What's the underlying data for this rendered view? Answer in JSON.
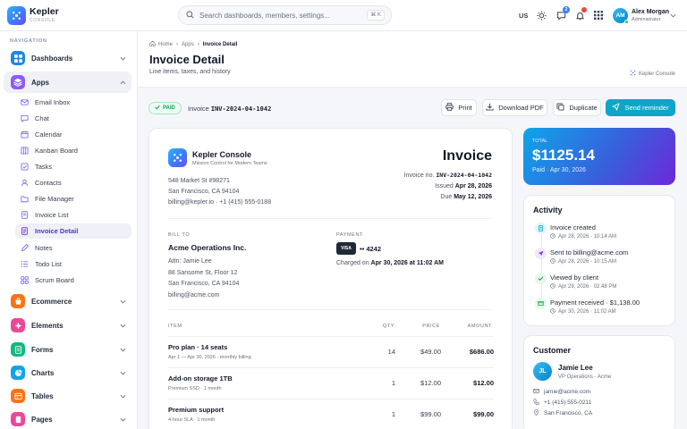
{
  "app": {
    "name": "Kepler",
    "sub": "CONSOLE"
  },
  "search": {
    "placeholder": "Search dashboards, members, settings...",
    "shortcut": "⌘ K"
  },
  "topbar": {
    "lang": "US",
    "messages_badge": "2",
    "notifications_badge": "",
    "user_name": "Alex Morgan",
    "user_role": "Administrator",
    "user_initials": "AM"
  },
  "sidebar": {
    "section": "NAVIGATION",
    "groups": [
      {
        "label": "Dashboards",
        "icon": "dashboard-icon",
        "color": "#1e88e5"
      },
      {
        "label": "Apps",
        "icon": "apps-icon",
        "color": "#8b5cf6"
      },
      {
        "label": "Ecommerce",
        "icon": "cart-icon",
        "color": "#f97316"
      },
      {
        "label": "Elements",
        "icon": "elements-icon",
        "color": "#ec4899"
      },
      {
        "label": "Forms",
        "icon": "forms-icon",
        "color": "#10b981"
      },
      {
        "label": "Charts",
        "icon": "chart-icon",
        "color": "#0ea5e9"
      },
      {
        "label": "Tables",
        "icon": "table-icon",
        "color": "#f97316"
      },
      {
        "label": "Pages",
        "icon": "pages-icon",
        "color": "#ec4899"
      }
    ],
    "apps": [
      {
        "label": "Email Inbox",
        "icon": "mail-icon"
      },
      {
        "label": "Chat",
        "icon": "chat-icon"
      },
      {
        "label": "Calendar",
        "icon": "calendar-icon"
      },
      {
        "label": "Kanban Board",
        "icon": "kanban-icon"
      },
      {
        "label": "Tasks",
        "icon": "tasks-icon"
      },
      {
        "label": "Contacts",
        "icon": "contacts-icon"
      },
      {
        "label": "File Manager",
        "icon": "folder-icon"
      },
      {
        "label": "Invoice List",
        "icon": "invoice-list-icon"
      },
      {
        "label": "Invoice Detail",
        "icon": "invoice-detail-icon"
      },
      {
        "label": "Notes",
        "icon": "notes-icon"
      },
      {
        "label": "Todo List",
        "icon": "todo-icon"
      },
      {
        "label": "Scrum Board",
        "icon": "scrum-icon"
      }
    ]
  },
  "breadcrumb": [
    "Home",
    "Apps",
    "Invoice Detail"
  ],
  "page": {
    "title": "Invoice Detail",
    "subtitle": "Line items, taxes, and history",
    "brand": "Kepler Console"
  },
  "status": {
    "badge": "PAID",
    "invoice_label": "Invoice",
    "invoice_id": "INV-2024-04-1042"
  },
  "actions": {
    "print": "Print",
    "download": "Download PDF",
    "duplicate": "Duplicate",
    "send": "Send reminder"
  },
  "company": {
    "name": "Kepler Console",
    "tagline": "Mission Control for Modern Teams",
    "address1": "548 Market St #98271",
    "address2": "San Francisco, CA 94104",
    "contact": "billing@kepler.io · +1 (415) 555-0188"
  },
  "invoice": {
    "heading": "Invoice",
    "no_label": "Invoice no.",
    "no": "INV-2024-04-1042",
    "issued_label": "Issued",
    "issued": "Apr 28, 2026",
    "due_label": "Due",
    "due": "May 12, 2026"
  },
  "bill_to": {
    "label": "BILL TO",
    "name": "Acme Operations Inc.",
    "attn": "Attn: Jamie Lee",
    "line1": "88 Sansome St, Floor 12",
    "line2": "San Francisco, CA 94104",
    "email": "billing@acme.com"
  },
  "payment": {
    "label": "PAYMENT",
    "brand": "VISA",
    "last4": "•• 4242",
    "charged_prefix": "Charged on",
    "charged": "Apr 30, 2026 at 11:02 AM"
  },
  "table": {
    "headers": {
      "item": "ITEM",
      "qty": "QTY",
      "price": "PRICE",
      "amount": "AMOUNT"
    },
    "rows": [
      {
        "name": "Pro plan · 14 seats",
        "desc": "Apr 1 — Apr 30, 2026 · monthly billing",
        "qty": "14",
        "price": "$49.00",
        "amount": "$686.00"
      },
      {
        "name": "Add-on storage 1TB",
        "desc": "Premium SSD · 1 month",
        "qty": "1",
        "price": "$12.00",
        "amount": "$12.00"
      },
      {
        "name": "Premium support",
        "desc": "4-hour SLA · 1 month",
        "qty": "1",
        "price": "$99.00",
        "amount": "$99.00"
      }
    ]
  },
  "total": {
    "label": "TOTAL",
    "amount": "$1125.14",
    "note": "Paid · Apr 30, 2026"
  },
  "activity": {
    "title": "Activity",
    "events": [
      {
        "title": "Invoice created",
        "time": "Apr 28, 2026 · 10:14 AM",
        "icon": "document-icon",
        "color": "#0ea5c6",
        "bg": "#e0f7fb"
      },
      {
        "title": "Sent to billing@acme.com",
        "time": "Apr 28, 2026 · 10:15 AM",
        "icon": "send-icon",
        "color": "#7c3aed",
        "bg": "#efe9ff"
      },
      {
        "title": "Viewed by client",
        "time": "Apr 29, 2026 · 02:48 PM",
        "icon": "check-icon",
        "color": "#16a34a",
        "bg": "#e6f8ec"
      },
      {
        "title": "Payment received · $1,138.00",
        "time": "Apr 30, 2026 · 11:02 AM",
        "icon": "card-icon",
        "color": "#16a34a",
        "bg": "#e6f8ec"
      }
    ]
  },
  "customer": {
    "title": "Customer",
    "initials": "JL",
    "name": "Jamie Lee",
    "role": "VP Operations · Acme",
    "email": "jamie@acme.com",
    "phone": "+1 (415) 555-0211",
    "location": "San Francisco, CA"
  }
}
